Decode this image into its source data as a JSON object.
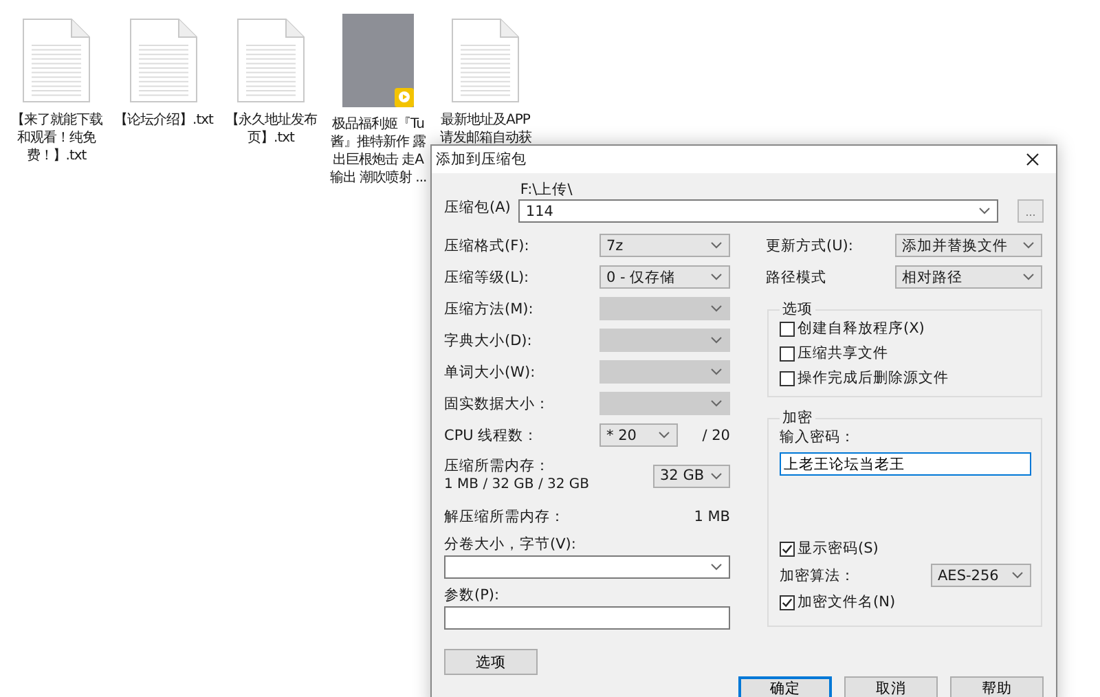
{
  "desktop_icons": [
    {
      "kind": "text-file",
      "lines": [
        "【来了就能下载",
        "和观看！纯免",
        "费！】.txt"
      ]
    },
    {
      "kind": "text-file",
      "lines": [
        "【论坛介绍】.txt"
      ]
    },
    {
      "kind": "text-file",
      "lines": [
        "【永久地址发布",
        "页】.txt"
      ]
    },
    {
      "kind": "video",
      "lines": [
        "极品福利姬『Tu",
        "酱』推特新作 露",
        "出巨根炮击 走A",
        "输出 潮吹喷射 ..."
      ]
    },
    {
      "kind": "text-file",
      "lines": [
        "最新地址及APP",
        "请发邮箱自动获"
      ]
    }
  ],
  "dialog": {
    "title": "添加到压缩包",
    "archive": {
      "label": "压缩包(A)",
      "path": "F:\\上传\\",
      "value": "114",
      "browse": "..."
    },
    "left_rows": [
      {
        "kind": "select",
        "label": "压缩格式(F):",
        "value": "7z",
        "disabled": false
      },
      {
        "kind": "select",
        "label": "压缩等级(L):",
        "value": "0 - 仅存储",
        "disabled": false
      },
      {
        "kind": "select",
        "label": "压缩方法(M):",
        "disabled": true
      },
      {
        "kind": "select",
        "label": "字典大小(D):",
        "disabled": true
      },
      {
        "kind": "select",
        "label": "单词大小(W):",
        "disabled": true
      },
      {
        "kind": "select",
        "label": "固实数据大小：",
        "disabled": true
      },
      {
        "kind": "threads",
        "label": "CPU 线程数：",
        "value": "* 20",
        "total": "/ 20"
      },
      {
        "kind": "memory",
        "label": "压缩所需内存：",
        "detail": "1 MB / 32 GB / 32 GB",
        "value": "32 GB"
      },
      {
        "kind": "info",
        "label": "解压缩所需内存：",
        "value": "1 MB"
      },
      {
        "kind": "combo",
        "label": "分卷大小，字节(V):"
      },
      {
        "kind": "input",
        "label": "参数(P):"
      }
    ],
    "options_button": "选项",
    "update_mode": {
      "label": "更新方式(U):",
      "value": "添加并替换文件"
    },
    "path_mode": {
      "label": "路径模式",
      "value": "相对路径"
    },
    "options_group": {
      "title": "选项",
      "items": [
        {
          "label": "创建自释放程序(X)",
          "checked": false
        },
        {
          "label": "压缩共享文件",
          "checked": false
        },
        {
          "label": "操作完成后删除源文件",
          "checked": false
        }
      ]
    },
    "encryption": {
      "title": "加密",
      "password_label": "输入密码：",
      "password": "上老王论坛当老王",
      "show_password": {
        "label": "显示密码(S)",
        "checked": true
      },
      "method_label": "加密算法：",
      "method": "AES-256",
      "encrypt_names": {
        "label": "加密文件名(N)",
        "checked": true
      }
    },
    "buttons": [
      {
        "label": "确定",
        "default": true
      },
      {
        "label": "取消",
        "default": false
      },
      {
        "label": "帮助",
        "default": false
      }
    ]
  }
}
